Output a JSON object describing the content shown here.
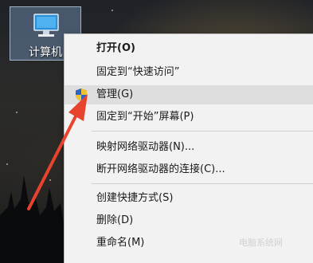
{
  "desktop": {
    "icon_label": "计算机"
  },
  "context_menu": {
    "items": [
      {
        "label": "打开(O)"
      },
      {
        "label": "固定到“快速访问”"
      },
      {
        "label": "管理(G)"
      },
      {
        "label": "固定到“开始”屏幕(P)"
      },
      {
        "label": "映射网络驱动器(N)..."
      },
      {
        "label": "断开网络驱动器的连接(C)..."
      },
      {
        "label": "创建快捷方式(S)"
      },
      {
        "label": "删除(D)"
      },
      {
        "label": "重命名(M)"
      }
    ]
  },
  "watermark": "电脑系统网",
  "colors": {
    "menu_background": "#f2f2f2",
    "menu_highlight": "#dedede",
    "arrow": "#e8432f",
    "icon_selection": "#7896be"
  }
}
